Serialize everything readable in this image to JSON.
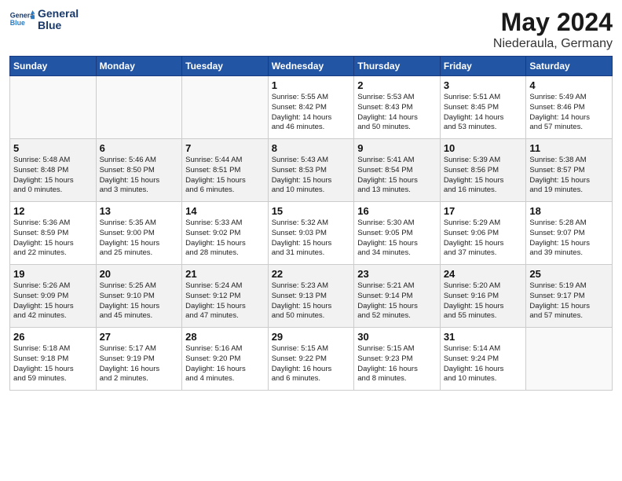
{
  "header": {
    "logo_line1": "General",
    "logo_line2": "Blue",
    "title": "May 2024",
    "subtitle": "Niederaula, Germany"
  },
  "days_of_week": [
    "Sunday",
    "Monday",
    "Tuesday",
    "Wednesday",
    "Thursday",
    "Friday",
    "Saturday"
  ],
  "weeks": [
    [
      {
        "day": "",
        "data": ""
      },
      {
        "day": "",
        "data": ""
      },
      {
        "day": "",
        "data": ""
      },
      {
        "day": "1",
        "data": "Sunrise: 5:55 AM\nSunset: 8:42 PM\nDaylight: 14 hours\nand 46 minutes."
      },
      {
        "day": "2",
        "data": "Sunrise: 5:53 AM\nSunset: 8:43 PM\nDaylight: 14 hours\nand 50 minutes."
      },
      {
        "day": "3",
        "data": "Sunrise: 5:51 AM\nSunset: 8:45 PM\nDaylight: 14 hours\nand 53 minutes."
      },
      {
        "day": "4",
        "data": "Sunrise: 5:49 AM\nSunset: 8:46 PM\nDaylight: 14 hours\nand 57 minutes."
      }
    ],
    [
      {
        "day": "5",
        "data": "Sunrise: 5:48 AM\nSunset: 8:48 PM\nDaylight: 15 hours\nand 0 minutes."
      },
      {
        "day": "6",
        "data": "Sunrise: 5:46 AM\nSunset: 8:50 PM\nDaylight: 15 hours\nand 3 minutes."
      },
      {
        "day": "7",
        "data": "Sunrise: 5:44 AM\nSunset: 8:51 PM\nDaylight: 15 hours\nand 6 minutes."
      },
      {
        "day": "8",
        "data": "Sunrise: 5:43 AM\nSunset: 8:53 PM\nDaylight: 15 hours\nand 10 minutes."
      },
      {
        "day": "9",
        "data": "Sunrise: 5:41 AM\nSunset: 8:54 PM\nDaylight: 15 hours\nand 13 minutes."
      },
      {
        "day": "10",
        "data": "Sunrise: 5:39 AM\nSunset: 8:56 PM\nDaylight: 15 hours\nand 16 minutes."
      },
      {
        "day": "11",
        "data": "Sunrise: 5:38 AM\nSunset: 8:57 PM\nDaylight: 15 hours\nand 19 minutes."
      }
    ],
    [
      {
        "day": "12",
        "data": "Sunrise: 5:36 AM\nSunset: 8:59 PM\nDaylight: 15 hours\nand 22 minutes."
      },
      {
        "day": "13",
        "data": "Sunrise: 5:35 AM\nSunset: 9:00 PM\nDaylight: 15 hours\nand 25 minutes."
      },
      {
        "day": "14",
        "data": "Sunrise: 5:33 AM\nSunset: 9:02 PM\nDaylight: 15 hours\nand 28 minutes."
      },
      {
        "day": "15",
        "data": "Sunrise: 5:32 AM\nSunset: 9:03 PM\nDaylight: 15 hours\nand 31 minutes."
      },
      {
        "day": "16",
        "data": "Sunrise: 5:30 AM\nSunset: 9:05 PM\nDaylight: 15 hours\nand 34 minutes."
      },
      {
        "day": "17",
        "data": "Sunrise: 5:29 AM\nSunset: 9:06 PM\nDaylight: 15 hours\nand 37 minutes."
      },
      {
        "day": "18",
        "data": "Sunrise: 5:28 AM\nSunset: 9:07 PM\nDaylight: 15 hours\nand 39 minutes."
      }
    ],
    [
      {
        "day": "19",
        "data": "Sunrise: 5:26 AM\nSunset: 9:09 PM\nDaylight: 15 hours\nand 42 minutes."
      },
      {
        "day": "20",
        "data": "Sunrise: 5:25 AM\nSunset: 9:10 PM\nDaylight: 15 hours\nand 45 minutes."
      },
      {
        "day": "21",
        "data": "Sunrise: 5:24 AM\nSunset: 9:12 PM\nDaylight: 15 hours\nand 47 minutes."
      },
      {
        "day": "22",
        "data": "Sunrise: 5:23 AM\nSunset: 9:13 PM\nDaylight: 15 hours\nand 50 minutes."
      },
      {
        "day": "23",
        "data": "Sunrise: 5:21 AM\nSunset: 9:14 PM\nDaylight: 15 hours\nand 52 minutes."
      },
      {
        "day": "24",
        "data": "Sunrise: 5:20 AM\nSunset: 9:16 PM\nDaylight: 15 hours\nand 55 minutes."
      },
      {
        "day": "25",
        "data": "Sunrise: 5:19 AM\nSunset: 9:17 PM\nDaylight: 15 hours\nand 57 minutes."
      }
    ],
    [
      {
        "day": "26",
        "data": "Sunrise: 5:18 AM\nSunset: 9:18 PM\nDaylight: 15 hours\nand 59 minutes."
      },
      {
        "day": "27",
        "data": "Sunrise: 5:17 AM\nSunset: 9:19 PM\nDaylight: 16 hours\nand 2 minutes."
      },
      {
        "day": "28",
        "data": "Sunrise: 5:16 AM\nSunset: 9:20 PM\nDaylight: 16 hours\nand 4 minutes."
      },
      {
        "day": "29",
        "data": "Sunrise: 5:15 AM\nSunset: 9:22 PM\nDaylight: 16 hours\nand 6 minutes."
      },
      {
        "day": "30",
        "data": "Sunrise: 5:15 AM\nSunset: 9:23 PM\nDaylight: 16 hours\nand 8 minutes."
      },
      {
        "day": "31",
        "data": "Sunrise: 5:14 AM\nSunset: 9:24 PM\nDaylight: 16 hours\nand 10 minutes."
      },
      {
        "day": "",
        "data": ""
      }
    ]
  ]
}
